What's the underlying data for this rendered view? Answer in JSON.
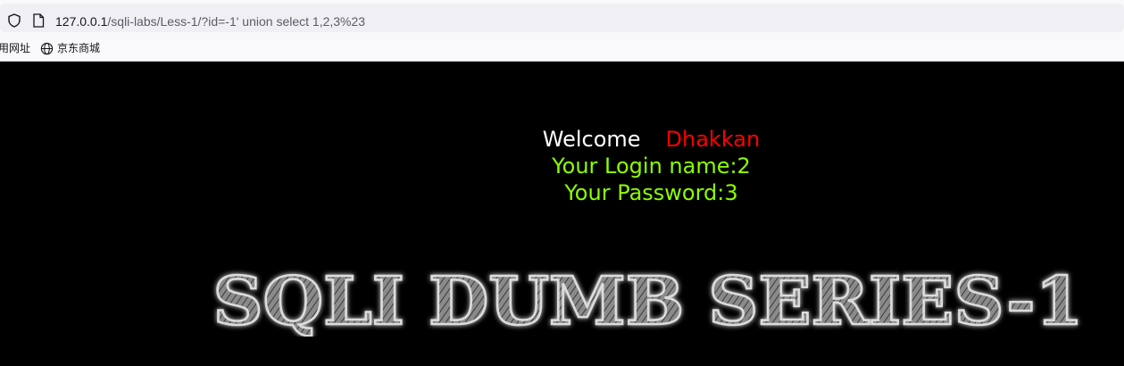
{
  "browser": {
    "url_host": "127.0.0.1",
    "url_path": "/sqli-labs/Less-1/?id=-1' union select 1,2,3%23",
    "bookmarks": [
      {
        "label": "用网址"
      },
      {
        "label": "京东商城",
        "icon": "globe-icon"
      }
    ]
  },
  "page": {
    "welcome_label": "Welcome",
    "user_name": "Dhakkan",
    "login_name_line": "Your Login name:2",
    "password_line": "Your Password:3",
    "banner_title": "SQLI DUMB SERIES-1"
  },
  "colors": {
    "background": "#000000",
    "welcome": "#ffffff",
    "name": "#ff0000",
    "result_text": "#8cff00"
  }
}
